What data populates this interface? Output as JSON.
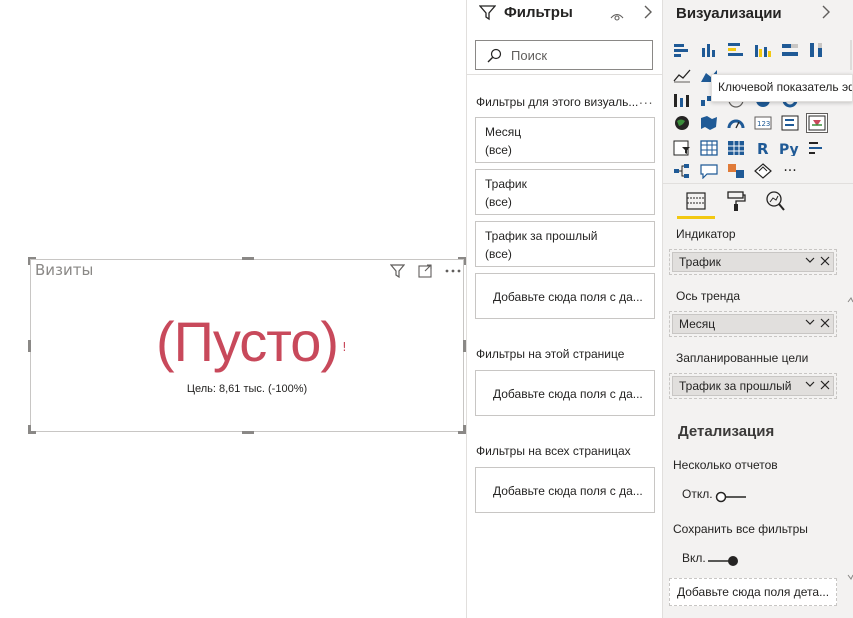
{
  "visual": {
    "title": "Визиты",
    "kpi_value": "Пусто",
    "kpi_open": "(",
    "kpi_close": ")",
    "warning": "!",
    "goal": "Цель: 8,61 тыс. (-100%)"
  },
  "filters": {
    "title": "Фильтры",
    "search_placeholder": "Поиск",
    "visual_section": "Фильтры для этого визуаль...",
    "visual_cards": [
      {
        "name": "Месяц",
        "value": "(все)"
      },
      {
        "name": "Трафик",
        "value": "(все)"
      },
      {
        "name": "Трафик за прошлый",
        "value": "(все)"
      }
    ],
    "drop_text": "Добавьте сюда поля с да...",
    "page_section": "Фильтры на этой странице",
    "all_section": "Фильтры на всех страницах",
    "dots": "..."
  },
  "viz": {
    "title": "Визуализации",
    "tooltip": "Ключевой показатель эф",
    "more": "···",
    "wells": {
      "indicator_label": "Индикатор",
      "indicator_value": "Трафик",
      "trend_label": "Ось тренда",
      "trend_value": "Месяц",
      "goals_label": "Запланированные цели",
      "goals_value": "Трафик за прошлый"
    },
    "drill": {
      "title": "Детализация",
      "multi_label": "Несколько отчетов",
      "multi_state": "Откл.",
      "keep_label": "Сохранить все фильтры",
      "keep_state": "Вкл.",
      "drop": "Добавьте сюда поля дета..."
    }
  },
  "colors": {
    "kpi": "#c8495b",
    "accent": "#f2c811",
    "icon_blue": "#1f5a96",
    "icon_yellow": "#f2c811"
  }
}
